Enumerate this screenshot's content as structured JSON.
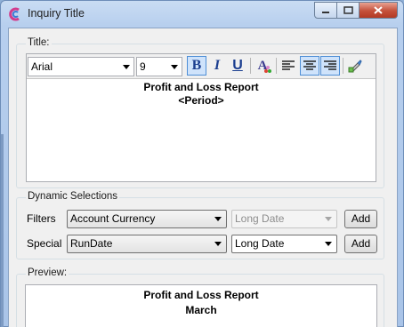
{
  "window": {
    "title": "Inquiry Title"
  },
  "title_group": {
    "label": "Title:"
  },
  "toolbar": {
    "font": "Arial",
    "size": "9",
    "bold_label": "B",
    "italic_label": "I",
    "underline_label": "U",
    "font_color_label": "A"
  },
  "editor": {
    "lines": [
      "Profit and Loss Report",
      "<Period>"
    ]
  },
  "dynamic": {
    "label": "Dynamic Selections",
    "filters": {
      "label": "Filters",
      "selection": "Account Currency",
      "format": "Long Date",
      "add_label": "Add"
    },
    "special": {
      "label": "Special",
      "selection": "RunDate",
      "format": "Long Date",
      "add_label": "Add"
    }
  },
  "preview": {
    "label": "Preview:",
    "lines": [
      "Profit and Loss Report",
      "March"
    ]
  }
}
